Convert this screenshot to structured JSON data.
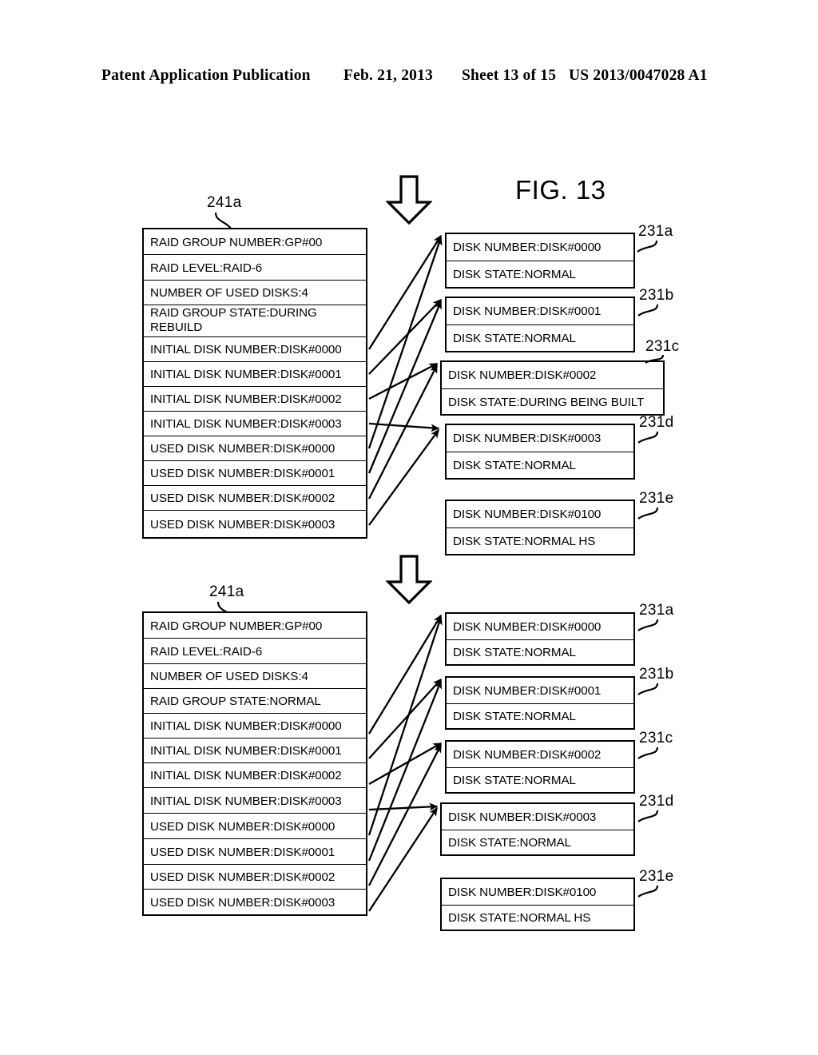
{
  "header": {
    "title": "Patent Application Publication",
    "date": "Feb. 21, 2013",
    "sheet": "Sheet 13 of 15",
    "pub_number": "US 2013/0047028 A1"
  },
  "figure": {
    "title": "FIG. 13",
    "down_arrow_icon": "down-arrow-icon"
  },
  "panels": [
    {
      "id": "top",
      "table": {
        "ref": "241a",
        "rows": [
          "RAID GROUP NUMBER:GP#00",
          "RAID LEVEL:RAID-6",
          "NUMBER OF USED DISKS:4",
          "RAID GROUP STATE:DURING REBUILD",
          "INITIAL DISK NUMBER:DISK#0000",
          "INITIAL DISK NUMBER:DISK#0001",
          "INITIAL DISK NUMBER:DISK#0002",
          "INITIAL DISK NUMBER:DISK#0003",
          "USED DISK NUMBER:DISK#0000",
          "USED DISK NUMBER:DISK#0001",
          "USED DISK NUMBER:DISK#0002",
          "USED DISK NUMBER:DISK#0003"
        ]
      },
      "disks": [
        {
          "ref": "231a",
          "number": "DISK NUMBER:DISK#0000",
          "state": "DISK STATE:NORMAL"
        },
        {
          "ref": "231b",
          "number": "DISK NUMBER:DISK#0001",
          "state": "DISK STATE:NORMAL"
        },
        {
          "ref": "231c",
          "number": "DISK NUMBER:DISK#0002",
          "state": "DISK STATE:DURING BEING BUILT"
        },
        {
          "ref": "231d",
          "number": "DISK NUMBER:DISK#0003",
          "state": "DISK STATE:NORMAL"
        },
        {
          "ref": "231e",
          "number": "DISK NUMBER:DISK#0100",
          "state": "DISK STATE:NORMAL HS"
        }
      ]
    },
    {
      "id": "bottom",
      "table": {
        "ref": "241a",
        "rows": [
          "RAID GROUP NUMBER:GP#00",
          "RAID LEVEL:RAID-6",
          "NUMBER OF USED DISKS:4",
          "RAID GROUP STATE:NORMAL",
          "INITIAL DISK NUMBER:DISK#0000",
          "INITIAL DISK NUMBER:DISK#0001",
          "INITIAL DISK NUMBER:DISK#0002",
          "INITIAL DISK NUMBER:DISK#0003",
          "USED DISK NUMBER:DISK#0000",
          "USED DISK NUMBER:DISK#0001",
          "USED DISK NUMBER:DISK#0002",
          "USED DISK NUMBER:DISK#0003"
        ]
      },
      "disks": [
        {
          "ref": "231a",
          "number": "DISK NUMBER:DISK#0000",
          "state": "DISK STATE:NORMAL"
        },
        {
          "ref": "231b",
          "number": "DISK NUMBER:DISK#0001",
          "state": "DISK STATE:NORMAL"
        },
        {
          "ref": "231c",
          "number": "DISK NUMBER:DISK#0002",
          "state": "DISK STATE:NORMAL"
        },
        {
          "ref": "231d",
          "number": "DISK NUMBER:DISK#0003",
          "state": "DISK STATE:NORMAL"
        },
        {
          "ref": "231e",
          "number": "DISK NUMBER:DISK#0100",
          "state": "DISK STATE:NORMAL HS"
        }
      ]
    }
  ],
  "colors": {
    "ink": "#000000",
    "paper": "#ffffff"
  }
}
